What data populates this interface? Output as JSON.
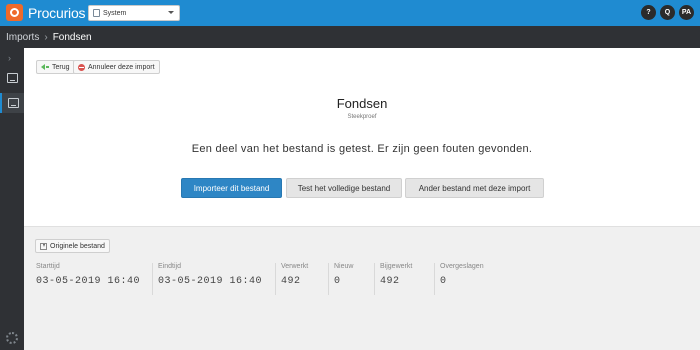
{
  "app": {
    "name": "Procurios"
  },
  "environment": {
    "selected": "System"
  },
  "top_icons": {
    "help": "?",
    "search": "Q",
    "user_initials": "PA"
  },
  "breadcrumb": {
    "parent": "Imports",
    "separator": "›",
    "current": "Fondsen"
  },
  "toolbar": {
    "back_label": "Terug",
    "cancel_label": "Annuleer deze import"
  },
  "main": {
    "title": "Fondsen",
    "subtitle": "Steekproef",
    "message": "Een deel van het bestand is getest. Er zijn geen fouten gevonden."
  },
  "actions": {
    "import_label": "Importeer dit bestand",
    "test_full_label": "Test het volledige bestand",
    "other_file_label": "Ander bestand met deze import"
  },
  "panel": {
    "original_file_label": "Originele bestand",
    "stats": [
      {
        "label": "Starttijd",
        "value": "03-05-2019 16:40"
      },
      {
        "label": "Eindtijd",
        "value": "03-05-2019 16:40"
      },
      {
        "label": "Verwerkt",
        "value": "492"
      },
      {
        "label": "Nieuw",
        "value": "0"
      },
      {
        "label": "Bijgewerkt",
        "value": "492"
      },
      {
        "label": "Overgeslagen",
        "value": "0"
      }
    ]
  },
  "colors": {
    "topbar": "#1f8bd1",
    "dark_bar": "#2f3135",
    "primary_button": "#2e86c5",
    "logo_accent": "#ef6a2a"
  }
}
